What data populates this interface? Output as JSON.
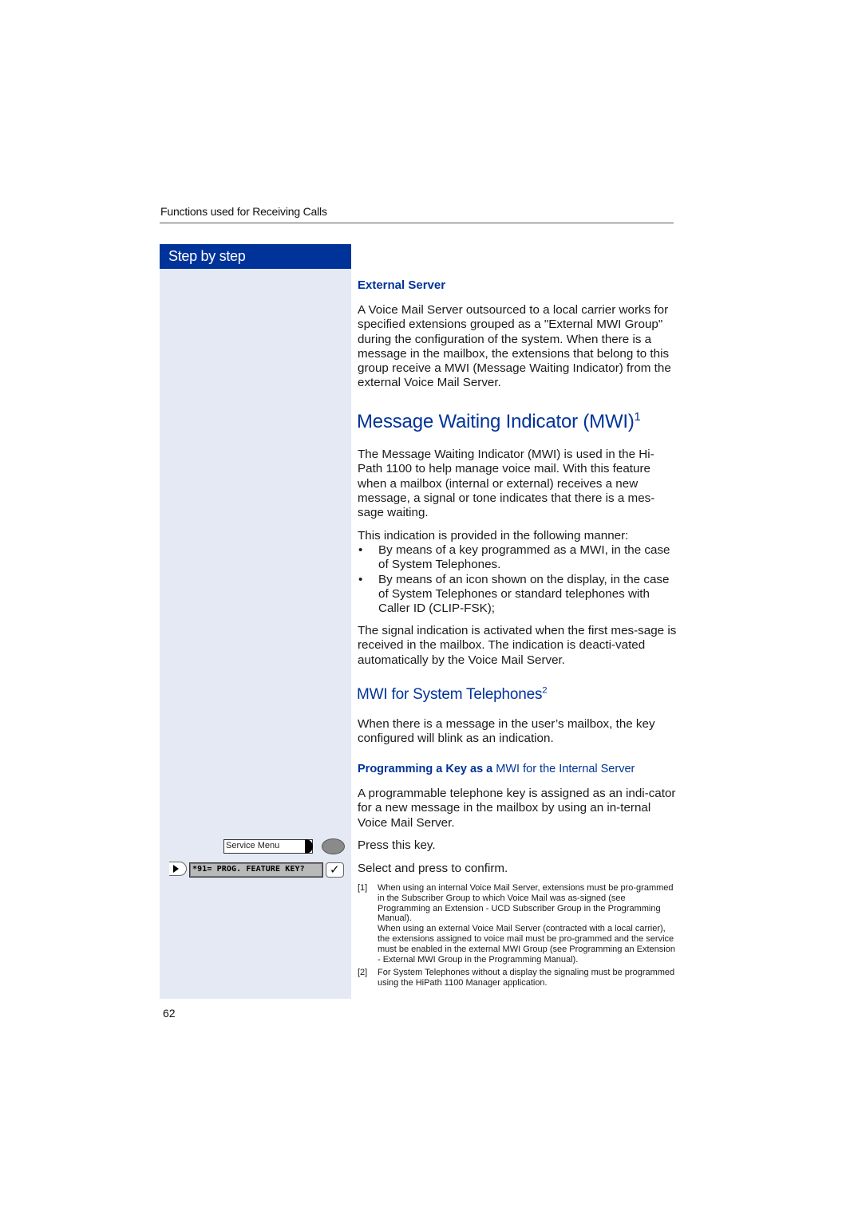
{
  "header": {
    "running_title": "Functions used for Receiving Calls"
  },
  "sidebar": {
    "title": "Step by step",
    "service_key_label": "Service Menu",
    "display_text": "*91= PROG. FEATURE KEY?",
    "ok_symbol": "✓",
    "colors": {
      "bar": "#003399",
      "column": "#e4e9f4"
    }
  },
  "external_server": {
    "heading": "External Server",
    "paragraph": "A Voice Mail Server outsourced to a local carrier works for specified extensions grouped as a \"External MWI Group\" during the configuration of the system. When there is a message in the mailbox, the extensions that belong to this group receive a MWI (Message Waiting Indicator) from the external Voice Mail Server."
  },
  "mwi": {
    "heading": "Message Waiting Indicator (MWI)",
    "footnote_ref": "1",
    "paragraph1": "The Message Waiting Indicator (MWI) is used in the Hi-Path 1100 to help manage voice mail. With this feature when a mailbox (internal or external) receives a new message, a signal or tone indicates that there is a mes-sage waiting.",
    "intro": "This indication is provided in the following manner:",
    "bullets": [
      "By means of a key programmed as a MWI, in the case of System Telephones.",
      "By means of an icon shown on the display, in the case of  System Telephones or standard telephones with Caller ID (CLIP-FSK);"
    ],
    "bullet_symbol": "•",
    "paragraph2": "The signal indication is activated when the first mes-sage is received in the mailbox. The indication is deacti-vated automatically by the Voice Mail Server."
  },
  "mwi_system": {
    "heading": "MWI for System Telephones",
    "footnote_ref": "2",
    "paragraph": "When there is a message in the user’s mailbox, the key configured will blink as an indication.",
    "subheading_bold": "Programming a Key as a",
    "subheading_rest": " MWI for the Internal Server",
    "paragraph2": "A programmable telephone key is assigned as an indi-cator for a new message in the mailbox by using an in-ternal Voice Mail Server.",
    "step1": "Press this key.",
    "step2": "Select and press to confirm."
  },
  "footnotes": [
    {
      "number": "[1]",
      "text_a": "When using an internal Voice Mail Server, extensions must be pro-grammed in the Subscriber Group to which Voice Mail was as-signed (see Programming an Extension - UCD Subscriber Group in the Programming Manual).",
      "text_b": "When using an external Voice Mail Server (contracted with a local carrier), the extensions assigned to voice mail must be pro-grammed and the service must be enabled in the external MWI Group (see Programming an Extension - External MWI Group in the Programming Manual)."
    },
    {
      "number": "[2]",
      "text_a": "For System Telephones without a display the signaling must be programmed using the HiPath 1100 Manager application."
    }
  ],
  "page_number": "62"
}
